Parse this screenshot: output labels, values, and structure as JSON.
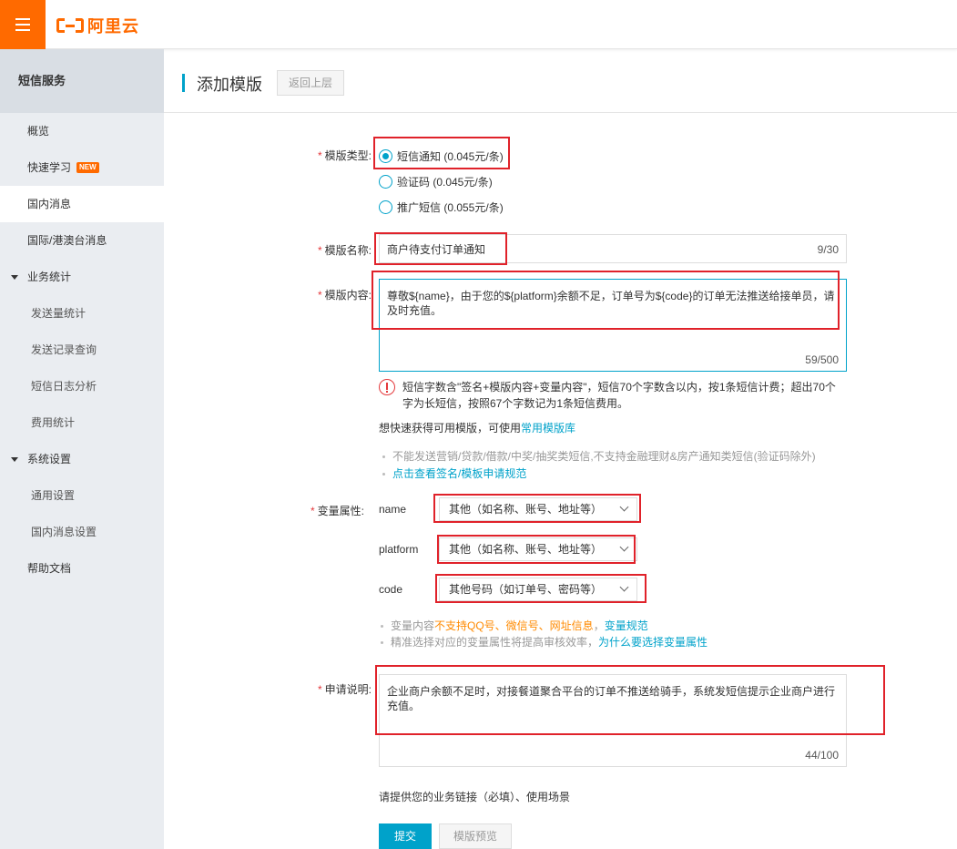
{
  "header": {
    "logo_text": "阿里云"
  },
  "sidebar": {
    "title": "短信服务",
    "items": [
      {
        "label": "概览"
      },
      {
        "label": "快速学习",
        "badge": "NEW"
      },
      {
        "label": "国内消息"
      },
      {
        "label": "国际/港澳台消息"
      },
      {
        "label": "业务统计"
      },
      {
        "label": "发送量统计"
      },
      {
        "label": "发送记录查询"
      },
      {
        "label": "短信日志分析"
      },
      {
        "label": "费用统计"
      },
      {
        "label": "系统设置"
      },
      {
        "label": "通用设置"
      },
      {
        "label": "国内消息设置"
      },
      {
        "label": "帮助文档"
      }
    ]
  },
  "page": {
    "title": "添加模版",
    "back_label": "返回上层"
  },
  "form": {
    "required_mark": "*",
    "template_type": {
      "label": "模版类型:",
      "options": [
        {
          "label": "短信通知 (0.045元/条)",
          "selected": true
        },
        {
          "label": "验证码 (0.045元/条)",
          "selected": false
        },
        {
          "label": "推广短信 (0.055元/条)",
          "selected": false
        }
      ]
    },
    "template_name": {
      "label": "模版名称:",
      "value": "商户待支付订单通知",
      "count": "9/30"
    },
    "template_content": {
      "label": "模版内容:",
      "value": "尊敬${name}，由于您的${platform}余额不足，订单号为${code}的订单无法推送给接单员，请及时充值。",
      "count": "59/500",
      "tip": "短信字数含\"签名+模版内容+变量内容\"，短信70个字数含以内，按1条短信计费；超出70个字为长短信，按照67个字数记为1条短信费用。",
      "hint_prefix": "想快速获得可用模版，可使用",
      "hint_link": "常用模版库",
      "rule_1": "不能发送营销/贷款/借款/中奖/抽奖类短信,不支持金融理财&房产通知类短信(验证码除外)",
      "rule_2_link": "点击查看签名/模板申请规范"
    },
    "variables": {
      "label": "变量属性:",
      "rows": [
        {
          "name": "name",
          "value": "其他（如名称、账号、地址等）"
        },
        {
          "name": "platform",
          "value": "其他（如名称、账号、地址等）"
        },
        {
          "name": "code",
          "value": "其他号码（如订单号、密码等）"
        }
      ],
      "note1_prefix": "变量内容",
      "note1_warn": "不支持QQ号、微信号、网址信息",
      "note1_sep": "，",
      "note1_link": "变量规范",
      "note2_prefix": "精准选择对应的变量属性将提高审核效率，",
      "note2_link": "为什么要选择变量属性"
    },
    "apply_desc": {
      "label": "申请说明:",
      "value": "企业商户余额不足时，对接餐道聚合平台的订单不推送给骑手，系统发短信提示企业商户进行充值。",
      "count": "44/100",
      "hint": "请提供您的业务链接（必填）、使用场景"
    },
    "submit_label": "提交",
    "preview_label": "模版预览"
  },
  "colors": {
    "brand": "#ff6a00",
    "accent": "#00a2ca",
    "highlight": "#e0222a",
    "required": "#e4393c"
  }
}
